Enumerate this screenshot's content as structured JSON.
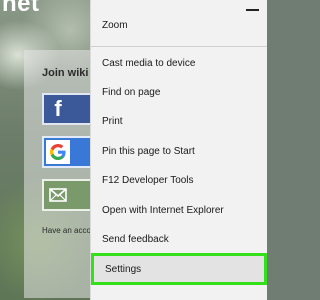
{
  "background": {
    "site_title": "net"
  },
  "join_panel": {
    "title": "Join wiki",
    "buttons": [
      {
        "icon": "facebook-icon",
        "color": "#3b5998"
      },
      {
        "icon": "google-icon",
        "color": "#3a78d8"
      },
      {
        "icon": "email-icon",
        "color": "#7a9a6b"
      }
    ],
    "have_account": "Have an acco"
  },
  "menu": {
    "zoom_label": "Zoom",
    "zoom_out_icon": "minus-icon",
    "items": [
      {
        "label": "Cast media to device"
      },
      {
        "label": "Find on page"
      },
      {
        "label": "Print"
      },
      {
        "label": "Pin this page to Start"
      },
      {
        "label": "F12 Developer Tools"
      },
      {
        "label": "Open with Internet Explorer"
      },
      {
        "label": "Send feedback"
      },
      {
        "label": "Settings",
        "highlighted": true,
        "highlight_color": "#33e01a"
      }
    ]
  }
}
